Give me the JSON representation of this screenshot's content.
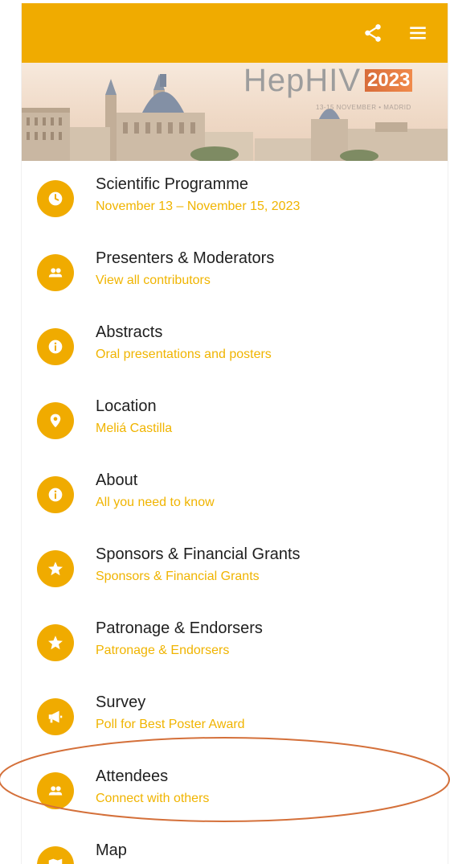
{
  "header": {
    "share_icon": "share-icon",
    "menu_icon": "hamburger-menu-icon",
    "color": "#f0ab00"
  },
  "banner": {
    "logo_text": "HepHIV",
    "year": "2023",
    "dates": "13-15 NOVEMBER • MADRID"
  },
  "menu": {
    "items": [
      {
        "title": "Scientific Programme",
        "subtitle": "November 13 – November 15, 2023",
        "icon": "clock-icon"
      },
      {
        "title": "Presenters & Moderators",
        "subtitle": "View all contributors",
        "icon": "people-icon"
      },
      {
        "title": "Abstracts",
        "subtitle": "Oral presentations and posters",
        "icon": "info-icon"
      },
      {
        "title": "Location",
        "subtitle": "Meliá Castilla",
        "icon": "location-pin-icon"
      },
      {
        "title": "About",
        "subtitle": "All you need to know",
        "icon": "info-icon"
      },
      {
        "title": "Sponsors & Financial Grants",
        "subtitle": "Sponsors & Financial Grants",
        "icon": "star-icon"
      },
      {
        "title": "Patronage & Endorsers",
        "subtitle": "Patronage & Endorsers",
        "icon": "star-icon"
      },
      {
        "title": "Survey",
        "subtitle": "Poll for Best Poster Award",
        "icon": "megaphone-icon"
      },
      {
        "title": "Attendees",
        "subtitle": "Connect with others",
        "icon": "people-icon"
      },
      {
        "title": "Map",
        "subtitle": "",
        "icon": "map-icon"
      }
    ]
  },
  "annotation": {
    "color": "#d4703a",
    "target": "Attendees"
  }
}
